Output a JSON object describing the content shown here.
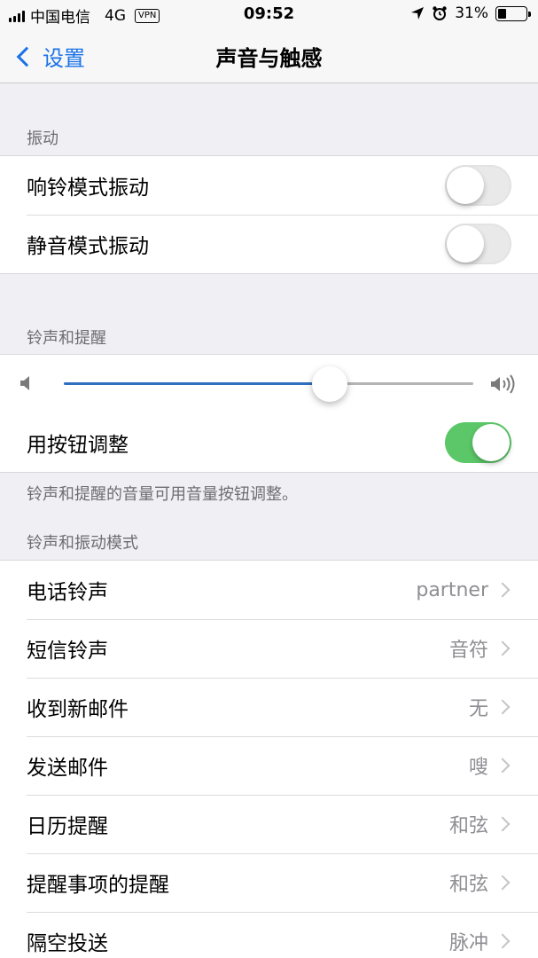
{
  "status_bar": {
    "carrier": "中国电信",
    "network": "4G",
    "vpn": "VPN",
    "time": "09:52",
    "battery_percent": "31%",
    "battery_level": 0.31
  },
  "nav": {
    "back_label": "设置",
    "title": "声音与触感"
  },
  "vibration": {
    "header": "振动",
    "items": [
      {
        "label": "响铃模式振动",
        "on": false
      },
      {
        "label": "静音模式振动",
        "on": false
      }
    ]
  },
  "ringer": {
    "header": "铃声和提醒",
    "volume_level": 0.65,
    "adjust_label": "用按钮调整",
    "adjust_on": true,
    "footnote": "铃声和提醒的音量可用音量按钮调整。"
  },
  "patterns": {
    "header": "铃声和振动模式",
    "items": [
      {
        "label": "电话铃声",
        "value": "partner"
      },
      {
        "label": "短信铃声",
        "value": "音符"
      },
      {
        "label": "收到新邮件",
        "value": "无"
      },
      {
        "label": "发送邮件",
        "value": "嗖"
      },
      {
        "label": "日历提醒",
        "value": "和弦"
      },
      {
        "label": "提醒事项的提醒",
        "value": "和弦"
      },
      {
        "label": "隔空投送",
        "value": "脉冲"
      }
    ]
  },
  "colors": {
    "accent": "#1a73e8",
    "toggle_on": "#5cc768",
    "slider_fill": "#2f6fbf"
  }
}
